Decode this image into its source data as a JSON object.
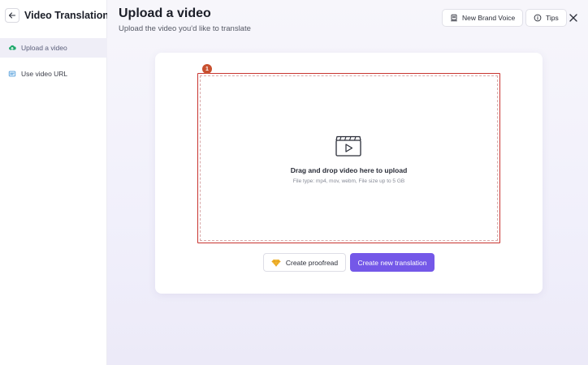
{
  "sidebar": {
    "title": "Video Translation",
    "back_icon": "arrow-left-icon",
    "items": [
      {
        "label": "Upload a video",
        "icon": "cloud-upload-icon",
        "active": true
      },
      {
        "label": "Use video URL",
        "icon": "link-icon",
        "active": false
      }
    ]
  },
  "header": {
    "title": "Upload a video",
    "subtitle": "Upload the video you'd like to translate",
    "brand_voice_label": "New Brand Voice",
    "tips_label": "Tips"
  },
  "upload": {
    "step_badge": "1",
    "drop_text": "Drag and drop video here to upload",
    "hint": "File type: mp4, mov, webm, File size up to 5 GB"
  },
  "actions": {
    "proofread_label": "Create proofread",
    "translate_label": "Create new translation"
  },
  "colors": {
    "accent": "#7458e8",
    "badge": "#c8502f",
    "dropzone_border": "#c8342f",
    "proofread_icon": "#f2b632",
    "upload_icon": "#1ea86b"
  }
}
